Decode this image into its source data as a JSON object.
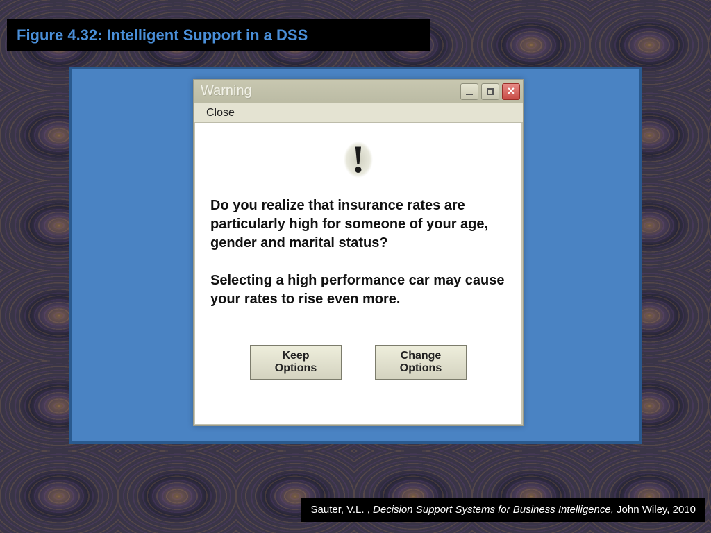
{
  "figure_label": "Figure 4.32:  Intelligent Support in a DSS",
  "dialog": {
    "title": "Warning",
    "menu": {
      "close": "Close"
    },
    "message": "Do you realize that insurance rates are particularly high for someone of your age, gender and marital status?\n\nSelecting a high performance car may cause your rates to rise even more.",
    "buttons": {
      "keep": "Keep\nOptions",
      "change": "Change\nOptions"
    }
  },
  "citation": {
    "author": "Sauter, V.L. , ",
    "title": "Decision Support Systems for Business Intelligence, ",
    "publisher": "John Wiley, 2010"
  }
}
